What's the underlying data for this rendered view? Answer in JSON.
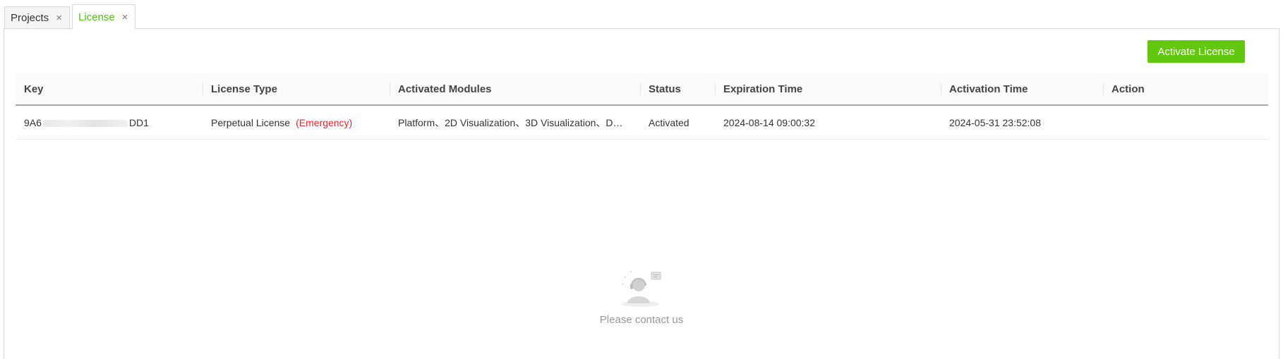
{
  "tabs": [
    {
      "label": "Projects",
      "close_icon": "×",
      "active": false
    },
    {
      "label": "License",
      "close_icon": "×",
      "active": true
    }
  ],
  "toolbar": {
    "activate_label": "Activate License"
  },
  "table": {
    "columns": [
      "Key",
      "License Type",
      "Activated Modules",
      "Status",
      "Expiration Time",
      "Activation Time",
      "Action"
    ],
    "rows": [
      {
        "key_prefix": "9A6",
        "key_suffix": "DD1",
        "license_type": "Perpetual License",
        "license_tag": "(Emergency)",
        "modules": "Platform、2D Visualization、3D Visualization、D…",
        "status": "Activated",
        "expiration": "2024-08-14 09:00:32",
        "activation": "2024-05-31 23:52:08",
        "action": ""
      }
    ]
  },
  "empty_state": {
    "icon": "support-agent-icon",
    "text": "Please contact us"
  },
  "colors": {
    "accent": "#62c80e",
    "active_tab_text": "#52c41a",
    "emergency": "#f5222d"
  }
}
